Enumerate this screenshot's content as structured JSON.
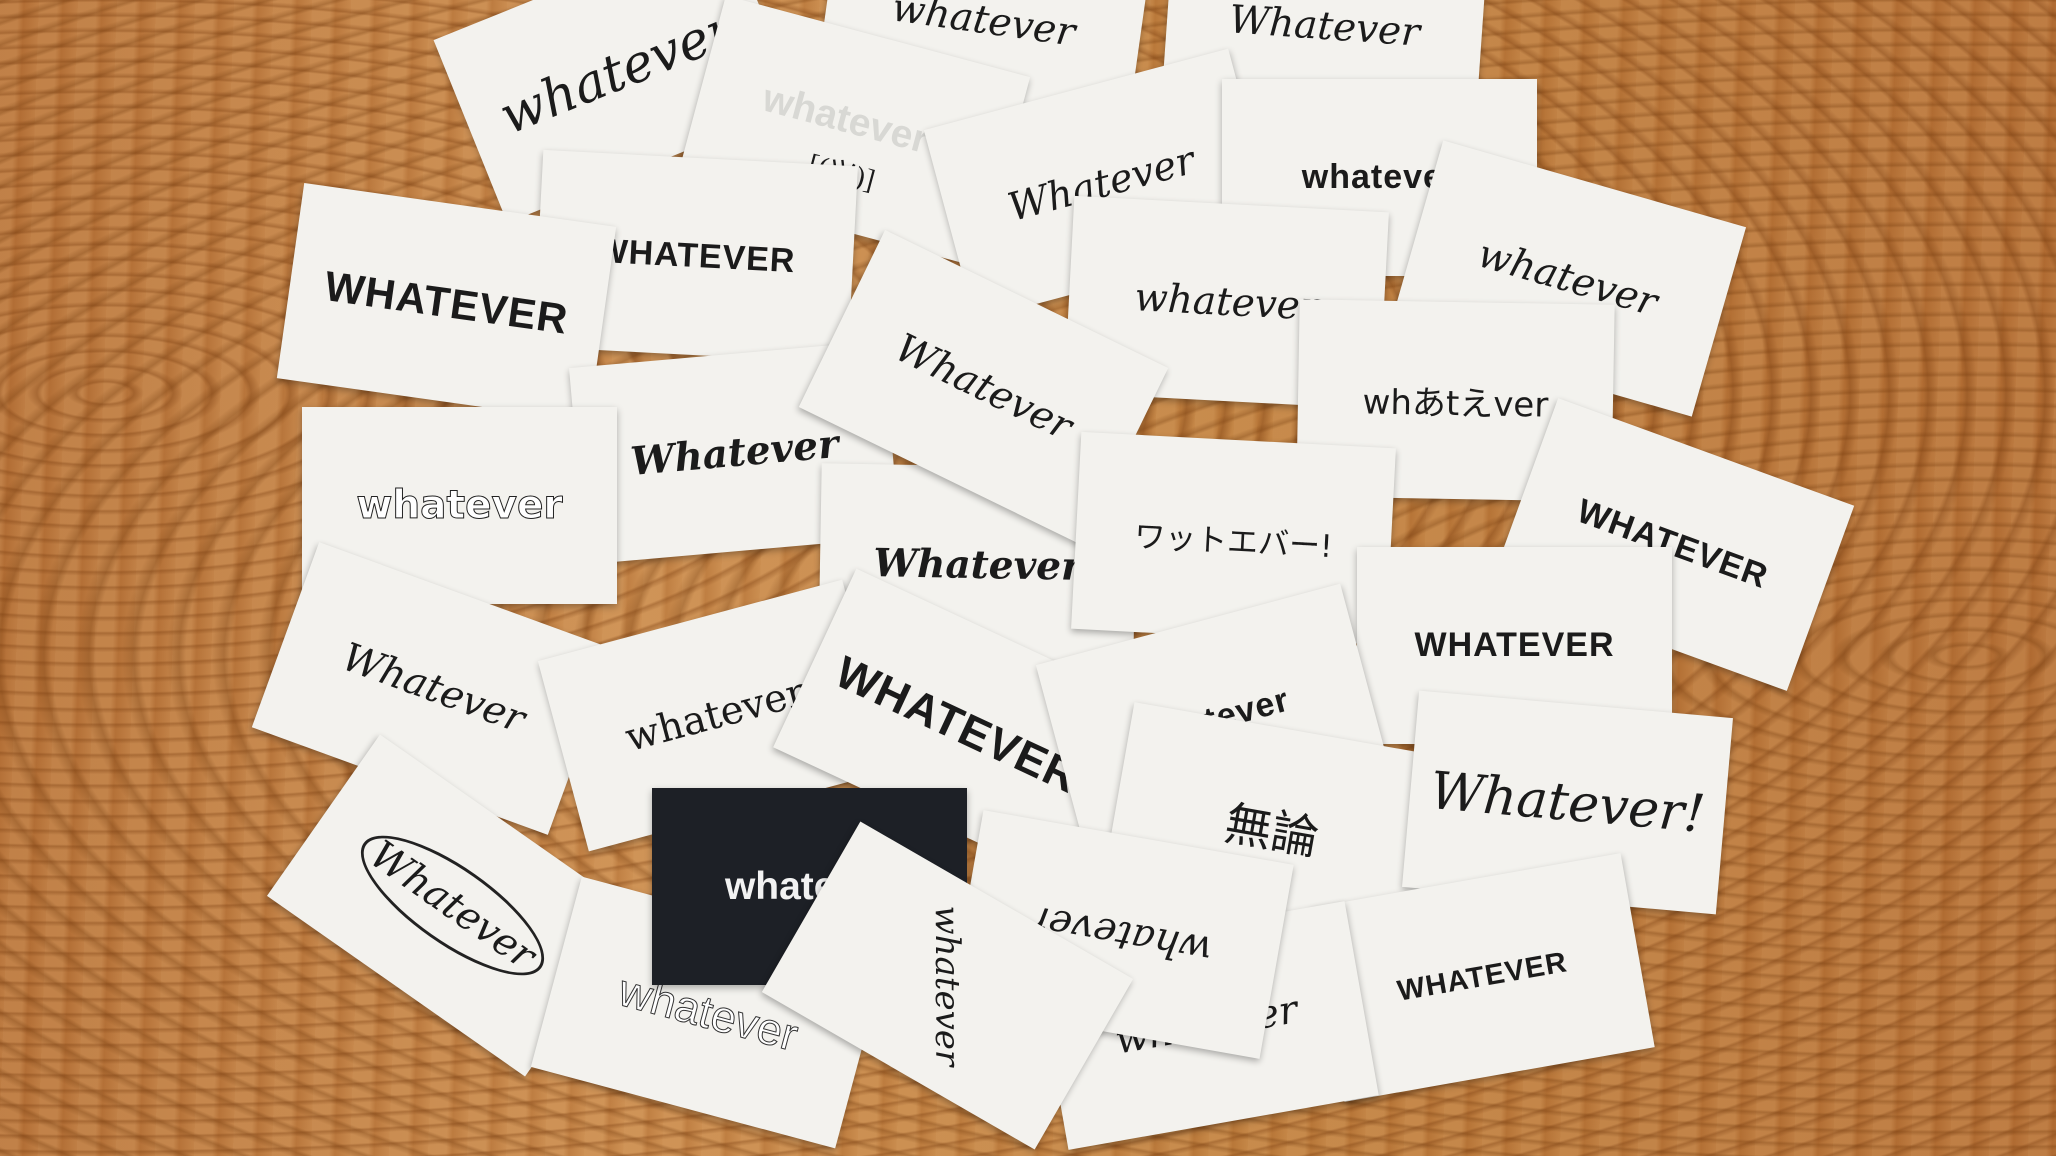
{
  "cards": [
    {
      "text": "whatever"
    },
    {
      "text": "whatever",
      "sub": "[(ツ)]"
    },
    {
      "text": "whatever"
    },
    {
      "text": "Whatever"
    },
    {
      "text": "Whatever"
    },
    {
      "text": "whatever"
    },
    {
      "text": "whatever"
    },
    {
      "text": "WHATEVER"
    },
    {
      "text": "WHATEVER"
    },
    {
      "text": "Whatever"
    },
    {
      "text": "whatever"
    },
    {
      "text": "whあtえver"
    },
    {
      "text": "whatever"
    },
    {
      "text": "Whatever"
    },
    {
      "text": "ワットエバー!"
    },
    {
      "text": "WHATEVER"
    },
    {
      "text": "Whatever"
    },
    {
      "text": "Whatever"
    },
    {
      "text": "whatever"
    },
    {
      "text": "WHATEVER"
    },
    {
      "text": "whatever"
    },
    {
      "text": "WHATEVER"
    },
    {
      "text": "無論"
    },
    {
      "text": "Whatever!"
    },
    {
      "text": "Whatever"
    },
    {
      "text": "whatever"
    },
    {
      "text": "whatever"
    },
    {
      "text": "WHATEVER"
    },
    {
      "text": "whatever"
    },
    {
      "text": "whatever"
    },
    {
      "text": "whatever"
    }
  ],
  "ghost": "whatever"
}
